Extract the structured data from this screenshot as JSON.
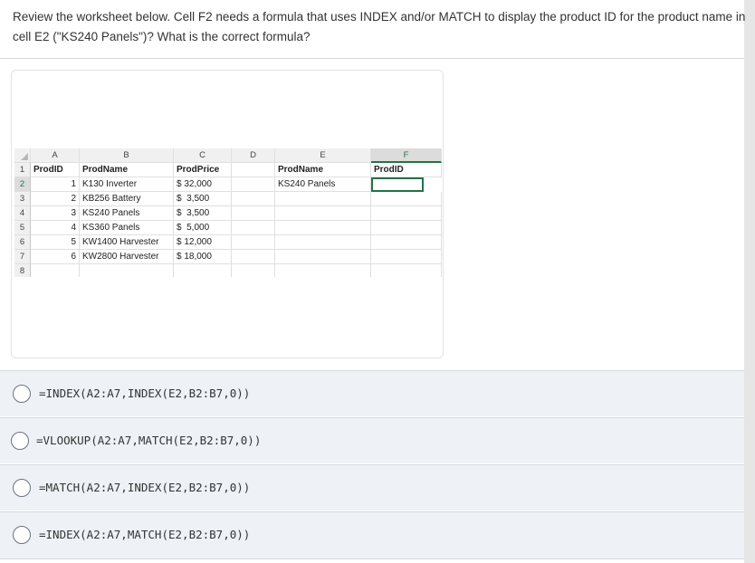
{
  "question": {
    "text": "Review the worksheet below. Cell F2 needs a formula that uses INDEX and/or MATCH to display the product ID for the product name in cell E2 (\"KS240 Panels\")? What is the correct formula?"
  },
  "spreadsheet": {
    "columns": [
      "A",
      "B",
      "C",
      "D",
      "E",
      "F"
    ],
    "rows": [
      [
        "ProdID",
        "ProdName",
        "ProdPrice",
        "",
        "ProdName",
        "ProdID"
      ],
      [
        "1",
        "K130 Inverter",
        "$ 32,000",
        "",
        "KS240 Panels",
        ""
      ],
      [
        "2",
        "KB256 Battery",
        "$  3,500",
        "",
        "",
        ""
      ],
      [
        "3",
        "KS240 Panels",
        "$  3,500",
        "",
        "",
        ""
      ],
      [
        "4",
        "KS360 Panels",
        "$  5,000",
        "",
        "",
        ""
      ],
      [
        "5",
        "KW1400 Harvester",
        "$ 12,000",
        "",
        "",
        ""
      ],
      [
        "6",
        "KW2800 Harvester",
        "$ 18,000",
        "",
        "",
        ""
      ],
      [
        "",
        "",
        "",
        "",
        "",
        ""
      ]
    ],
    "row_numbers": [
      "1",
      "2",
      "3",
      "4",
      "5",
      "6",
      "7",
      "8"
    ],
    "selected_cell": "F2",
    "accent_color": "#217346"
  },
  "options": [
    {
      "label": "=INDEX(A2:A7,INDEX(E2,B2:B7,0))"
    },
    {
      "label": "=VLOOKUP(A2:A7,MATCH(E2,B2:B7,0))"
    },
    {
      "label": "=MATCH(A2:A7,INDEX(E2,B2:B7,0))"
    },
    {
      "label": "=INDEX(A2:A7,MATCH(E2,B2:B7,0))"
    }
  ]
}
